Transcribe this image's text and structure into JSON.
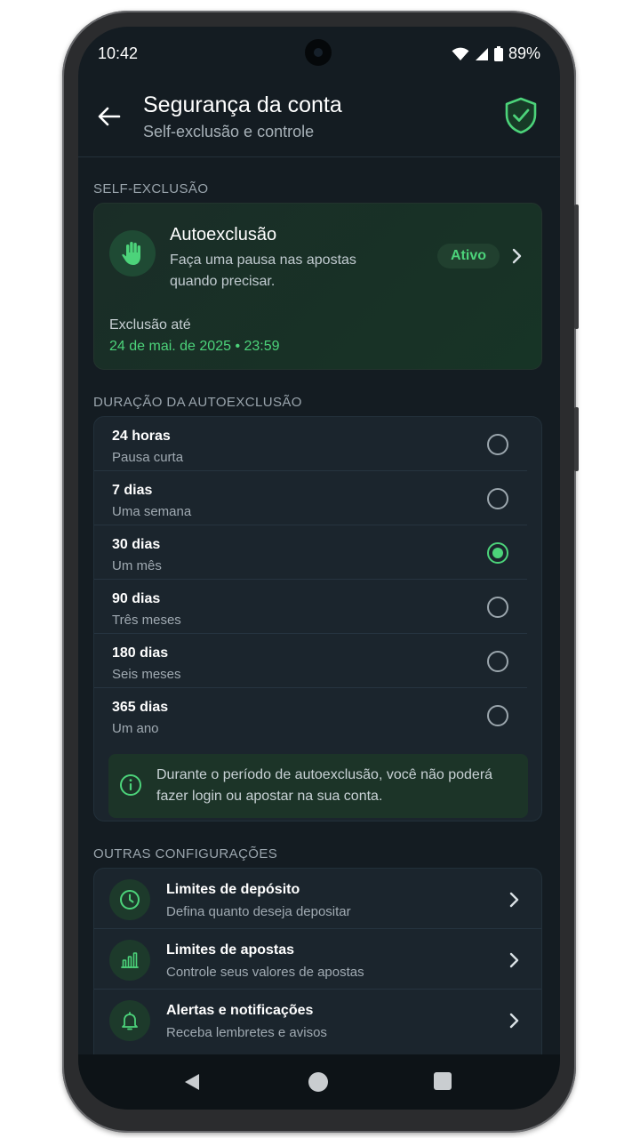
{
  "status_bar": {
    "time": "10:42",
    "battery": "89%"
  },
  "header": {
    "title": "Segurança da conta",
    "subtitle": "Self-exclusão e controle"
  },
  "self_exclusion": {
    "section_label": "SELF-EXCLUSÃO",
    "title": "Autoexclusão",
    "description": "Faça uma pausa nas apostas quando precisar.",
    "badge": "Ativo",
    "until_label": "Exclusão até",
    "until_value": "24 de mai. de 2025 • 23:59"
  },
  "duration": {
    "section_label": "DURAÇÃO DA AUTOEXCLUSÃO",
    "selected_index": 2,
    "options": [
      {
        "title": "24 horas",
        "subtitle": "Pausa curta"
      },
      {
        "title": "7 dias",
        "subtitle": "Uma semana"
      },
      {
        "title": "30 dias",
        "subtitle": "Um mês"
      },
      {
        "title": "90 dias",
        "subtitle": "Três meses"
      },
      {
        "title": "180 dias",
        "subtitle": "Seis meses"
      },
      {
        "title": "365 dias",
        "subtitle": "Um ano"
      }
    ],
    "info": "Durante o período de autoexclusão, você não poderá fazer login ou apostar na sua conta."
  },
  "other_settings": {
    "section_label": "OUTRAS CONFIGURAÇÕES",
    "items": [
      {
        "title": "Limites de depósito",
        "subtitle": "Defina quanto deseja depositar",
        "icon": "clock-icon"
      },
      {
        "title": "Limites de apostas",
        "subtitle": "Controle seus valores de apostas",
        "icon": "bar-chart-icon"
      },
      {
        "title": "Alertas e notificações",
        "subtitle": "Receba lembretes e avisos",
        "icon": "bell-icon"
      }
    ]
  },
  "colors": {
    "accent": "#4cd37a",
    "background": "#141c22",
    "card": "#1b252d"
  }
}
